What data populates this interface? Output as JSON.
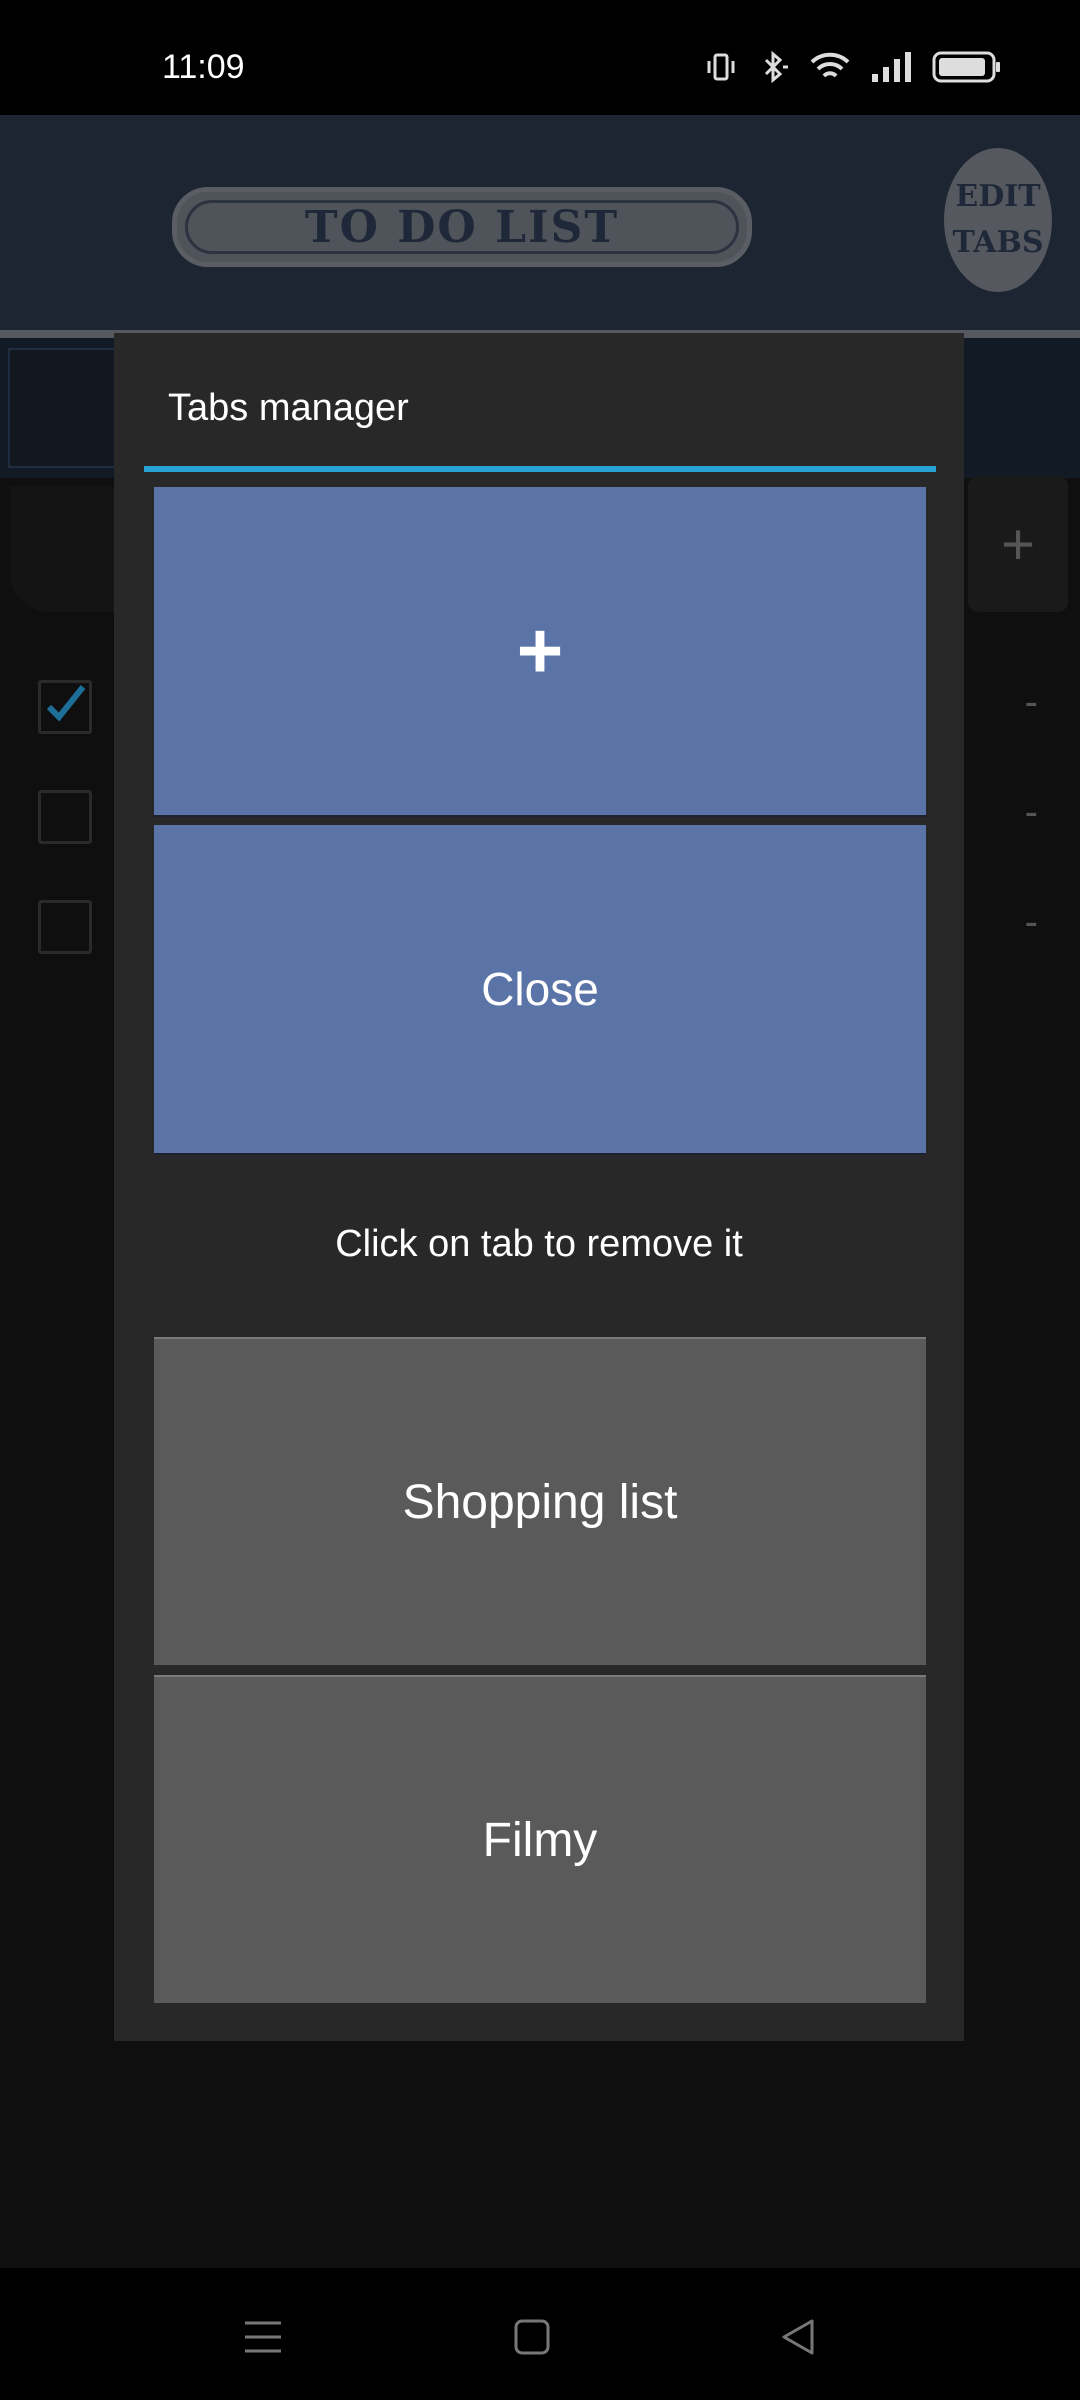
{
  "status_bar": {
    "time": "11:09",
    "icons": [
      "vibrate-icon",
      "bluetooth-icon",
      "wifi-icon",
      "signal-icon",
      "battery-icon"
    ]
  },
  "header": {
    "logo_text": "TO DO LIST",
    "edit_tabs_line1": "EDIT",
    "edit_tabs_line2": "TABS"
  },
  "background_list": {
    "add_label": "+",
    "rows": [
      {
        "checked": true,
        "remove_label": "-"
      },
      {
        "checked": false,
        "remove_label": "-"
      },
      {
        "checked": false,
        "remove_label": "-"
      }
    ]
  },
  "dialog": {
    "title": "Tabs manager",
    "add_button_label": "+",
    "close_button_label": "Close",
    "hint": "Click on tab to remove it",
    "tabs": [
      {
        "label": "Shopping list"
      },
      {
        "label": "Filmy"
      }
    ]
  },
  "navbar": {
    "icons": [
      "menu-icon",
      "home-icon",
      "back-icon"
    ]
  },
  "colors": {
    "accent": "#2aa3d4",
    "button_blue": "#5a74a7",
    "tab_gray": "#5a5a5a",
    "dialog_bg": "#282828",
    "header_bg": "#1d2533"
  }
}
